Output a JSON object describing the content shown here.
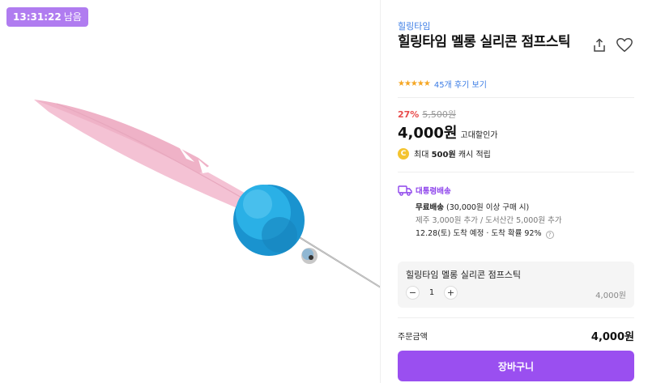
{
  "timer": {
    "time": "13:31:22",
    "suffix": "남음"
  },
  "product": {
    "brand": "힐링타임",
    "title": "힐링타임 멜롱 실리콘 점프스틱",
    "rating_stars": "★★★★★",
    "review_link": "45개 후기 보기"
  },
  "pricing": {
    "discount": "27%",
    "original_price": "5,500원",
    "price": "4,000원",
    "price_note": "고대할인가",
    "cash_prefix": "최대",
    "cash_amount": "500원",
    "cash_suffix": "캐시 적립"
  },
  "shipping": {
    "type": "대통령배송",
    "free_label": "무료배송",
    "free_condition": "(30,000원 이상 구매 시)",
    "extra_fee": "제주 3,000원 추가 / 도서산간 5,000원 추가",
    "eta": "12.28(토) 도착 예정 · 도착 확률 92%"
  },
  "option": {
    "name": "힐링타임 멜롱 실리콘 점프스틱",
    "quantity": "1",
    "price": "4,000원"
  },
  "order": {
    "total_label": "주문금액",
    "total_value": "4,000원",
    "cart_button": "장바구니"
  },
  "colors": {
    "accent_purple": "#9a4ff0",
    "timer_bg": "#b07cf0",
    "discount_red": "#e84b4b",
    "link_blue": "#3b7ce5",
    "feather_pink": "#f4c2d4",
    "pompom_blue": "#1f9fd8"
  },
  "icons": [
    "share-icon",
    "heart-icon",
    "truck-icon",
    "coin-icon",
    "help-icon"
  ]
}
